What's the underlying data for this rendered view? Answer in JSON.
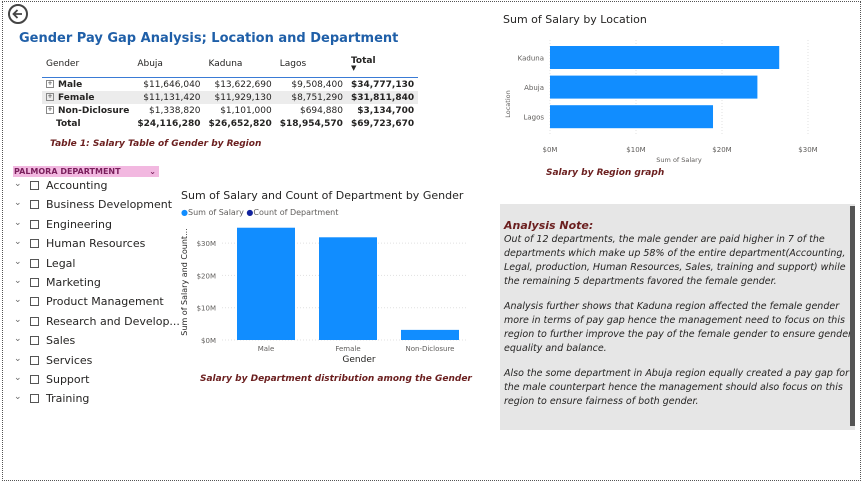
{
  "main_title": "Gender Pay Gap Analysis; Location and Department",
  "salary_table": {
    "headers": [
      "Gender",
      "Abuja",
      "Kaduna",
      "Lagos",
      "Total"
    ],
    "rows": [
      {
        "gender": "Male",
        "abuja": "$11,646,040",
        "kaduna": "$13,622,690",
        "lagos": "$9,508,400",
        "total": "$34,777,130"
      },
      {
        "gender": "Female",
        "abuja": "$11,131,420",
        "kaduna": "$11,929,130",
        "lagos": "$8,751,290",
        "total": "$31,811,840"
      },
      {
        "gender": "Non-Diclosure",
        "abuja": "$1,338,820",
        "kaduna": "$1,101,000",
        "lagos": "$694,880",
        "total": "$3,134,700"
      }
    ],
    "total_row": {
      "gender": "Total",
      "abuja": "$24,116,280",
      "kaduna": "$26,652,820",
      "lagos": "$18,954,570",
      "total": "$69,723,670"
    },
    "caption": "Table 1: Salary Table  of Gender by Region"
  },
  "department_slicer": {
    "title": "PALMORA DEPARTMENT",
    "items": [
      "Accounting",
      "Business Development",
      "Engineering",
      "Human Resources",
      "Legal",
      "Marketing",
      "Product Management",
      "Research and Develop...",
      "Sales",
      "Services",
      "Support",
      "Training"
    ]
  },
  "location_chart": {
    "title": "Sum of Salary by Location",
    "caption": "Salary by Region graph"
  },
  "gender_chart": {
    "title": "Sum of Salary and Count of Department by Gender",
    "legend": [
      "Sum of Salary",
      "Count of Department"
    ],
    "caption": "Salary by Department distribution among the Gender"
  },
  "analysis_note": {
    "title": "Analysis Note:",
    "p1": "Out of 12 departments, the male gender are paid higher in 7 of the departments which make up 58% of the entire department(Accounting, Legal, production, Human Resources, Sales,  training and support) while the remaining 5 departments favored the female gender.",
    "p2": "Analysis further shows that Kaduna region affected the female gender more in terms of pay gap hence the management need to focus on this region to further improve the pay of the female gender to ensure gender equality and balance.",
    "p3": "Also the some department in Abuja region equally created a pay gap for the male counterpart hence the management should also focus on this region to ensure fairness of both gender."
  },
  "colors": {
    "bar": "#118dff",
    "count_series": "#12239e",
    "title_blue": "#1f5fa8",
    "caption_red": "#6b1f1f",
    "slicer_head": "#f2b8e0"
  },
  "chart_data": [
    {
      "type": "bar",
      "orientation": "horizontal",
      "title": "Sum of Salary by Location",
      "xlabel": "Sum of Salary",
      "ylabel": "Location",
      "categories": [
        "Kaduna",
        "Abuja",
        "Lagos"
      ],
      "values": [
        26652820,
        24116280,
        18954570
      ],
      "xlim": [
        0,
        30000000
      ],
      "ticks": [
        "$0M",
        "$10M",
        "$20M",
        "$30M"
      ],
      "grid": true
    },
    {
      "type": "bar",
      "title": "Sum of Salary and Count of Department by Gender",
      "xlabel": "Gender",
      "ylabel": "Sum of Salary and Count...",
      "categories": [
        "Male",
        "Female",
        "Non-Diclosure"
      ],
      "series": [
        {
          "name": "Sum of Salary",
          "values": [
            34777130,
            31811840,
            3134700
          ]
        },
        {
          "name": "Count of Department",
          "values": [
            0,
            0,
            0
          ]
        }
      ],
      "ylim": [
        0,
        35000000
      ],
      "ticks": [
        "$0M",
        "$10M",
        "$20M",
        "$30M"
      ],
      "grid": true,
      "legend": "top-left"
    }
  ]
}
